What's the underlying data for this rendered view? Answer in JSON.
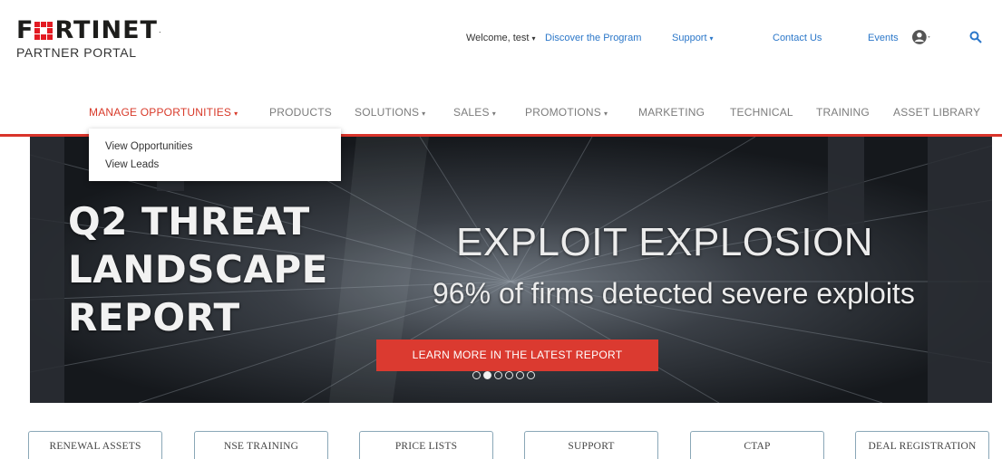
{
  "brand": {
    "logo_text_left": "F",
    "logo_text_right": "RTINET",
    "logo_tm": ".",
    "subtitle": "PARTNER PORTAL",
    "accent_color": "#d9342b"
  },
  "topnav": {
    "welcome": "Welcome, test",
    "discover": "Discover the Program",
    "support": "Support",
    "contact": "Contact Us",
    "events": "Events",
    "user_icon": "user-circle-icon",
    "search_icon": "search-icon"
  },
  "mainnav": {
    "items": [
      {
        "label": "MANAGE OPPORTUNITIES",
        "caret": true,
        "active": true
      },
      {
        "label": "PRODUCTS"
      },
      {
        "label": "SOLUTIONS",
        "caret": true
      },
      {
        "label": "SALES",
        "caret": true
      },
      {
        "label": "PROMOTIONS",
        "caret": true
      },
      {
        "label": "MARKETING"
      },
      {
        "label": "TECHNICAL"
      },
      {
        "label": "TRAINING"
      },
      {
        "label": "ASSET LIBRARY"
      }
    ]
  },
  "dropdown": {
    "items": [
      "View Opportunities",
      "View Leads"
    ]
  },
  "hero": {
    "title_lines": [
      "Q2 THREAT",
      "LANDSCAPE",
      "REPORT"
    ],
    "headline": "EXPLOIT EXPLOSION",
    "subheadline": "96% of firms detected severe exploits",
    "cta": "LEARN MORE IN THE LATEST REPORT",
    "slides_total": 6,
    "active_slide": 2
  },
  "quicklinks": [
    "RENEWAL ASSETS",
    "NSE TRAINING",
    "PRICE LISTS",
    "SUPPORT",
    "CTAP",
    "DEAL REGISTRATION"
  ]
}
